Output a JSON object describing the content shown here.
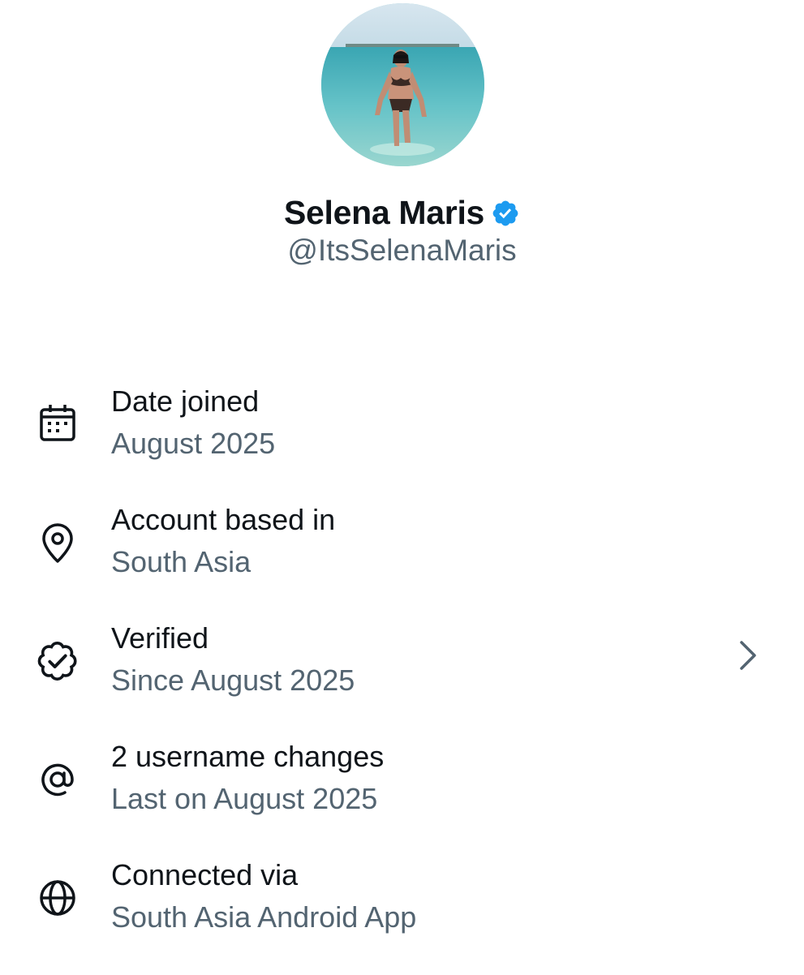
{
  "profile": {
    "display_name": "Selena Maris",
    "handle": "@ItsSelenaMaris",
    "avatar_icon": "profile-photo-beach",
    "verified_icon": "verified-badge-icon"
  },
  "colors": {
    "primary_text": "#0f1419",
    "secondary_text": "#536471",
    "verified_blue": "#1d9bf0"
  },
  "about": {
    "items": [
      {
        "icon": "calendar-icon",
        "label": "Date joined",
        "value": "August 2025"
      },
      {
        "icon": "location-pin-icon",
        "label": "Account based in",
        "value": "South Asia"
      },
      {
        "icon": "verified-outline-icon",
        "label": "Verified",
        "value": "Since August 2025",
        "chevron": "chevron-right-icon"
      },
      {
        "icon": "at-sign-icon",
        "label": "2 username changes",
        "value": "Last on August 2025"
      },
      {
        "icon": "globe-icon",
        "label": "Connected via",
        "value": "South Asia Android App"
      }
    ]
  }
}
